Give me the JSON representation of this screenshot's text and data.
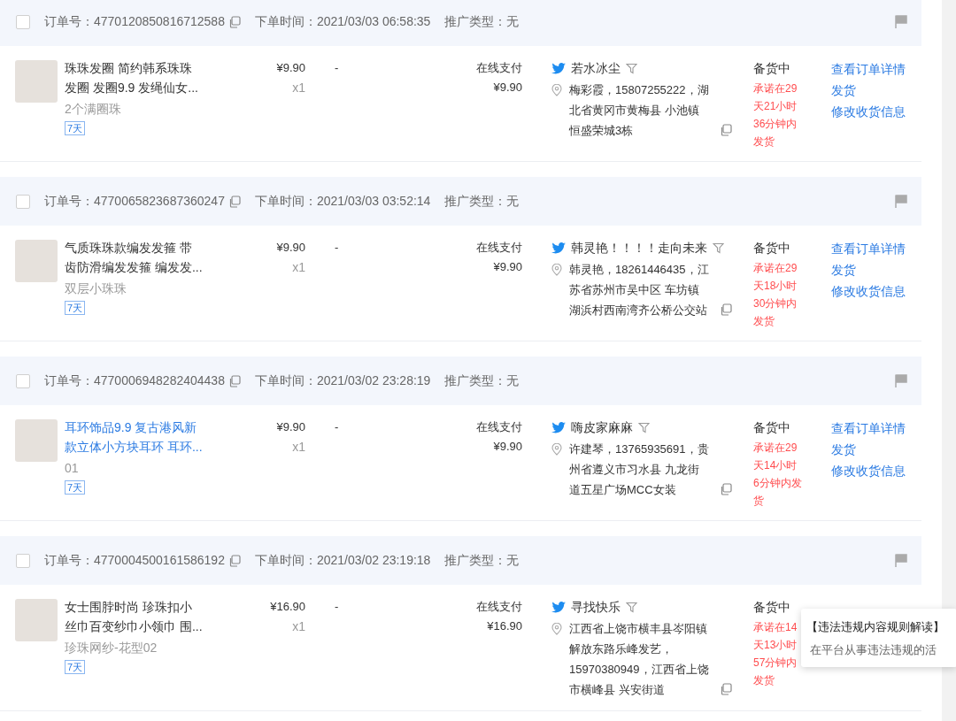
{
  "orders": [
    {
      "selected": false,
      "order_no": "订单号：4770120850816712588",
      "order_time": "下单时间：2021/03/03 06:58:35",
      "promo_type": "推广类型：无",
      "product": {
        "title": "珠珠发圈 简约韩系珠珠发圈 发圈9.9 发绳仙女...",
        "hovered": false,
        "variant": "2个满圈珠",
        "tag": "7天"
      },
      "price": "¥9.90",
      "quantity": "x1",
      "discount": "-",
      "payment_method": "在线支付",
      "paid": "¥9.90",
      "buyer": "若水冰尘",
      "address": "梅彩霞，15807255222，湖北省黄冈市黄梅县 小池镇恒盛荣城3栋",
      "status": "备货中",
      "promise": "承诺在29天21小时36分钟内发货",
      "actions": [
        "查看订单详情",
        "发货",
        "修改收货信息"
      ]
    },
    {
      "selected": false,
      "order_no": "订单号：4770065823687360247",
      "order_time": "下单时间：2021/03/03 03:52:14",
      "promo_type": "推广类型：无",
      "product": {
        "title": "气质珠珠款编发发箍 带齿防滑编发发箍 编发发...",
        "hovered": false,
        "variant": "双层小珠珠",
        "tag": "7天"
      },
      "price": "¥9.90",
      "quantity": "x1",
      "discount": "-",
      "payment_method": "在线支付",
      "paid": "¥9.90",
      "buyer": "韩灵艳！！！！走向未来",
      "address": "韩灵艳，18261446435，江苏省苏州市吴中区 车坊镇湖浜村西南湾齐公桥公交站",
      "status": "备货中",
      "promise": "承诺在29天18小时30分钟内发货",
      "actions": [
        "查看订单详情",
        "发货",
        "修改收货信息"
      ]
    },
    {
      "selected": false,
      "order_no": "订单号：4770006948282404438",
      "order_time": "下单时间：2021/03/02 23:28:19",
      "promo_type": "推广类型：无",
      "product": {
        "title": "耳环饰品9.9 复古港风新款立体小方块耳环 耳环...",
        "hovered": true,
        "variant": "01",
        "tag": "7天"
      },
      "price": "¥9.90",
      "quantity": "x1",
      "discount": "-",
      "payment_method": "在线支付",
      "paid": "¥9.90",
      "buyer": "嗨皮家麻麻",
      "address": "许建琴，13765935691，贵州省遵义市习水县 九龙街道五星广场MCC女装",
      "status": "备货中",
      "promise": "承诺在29天14小时6分钟内发货",
      "actions": [
        "查看订单详情",
        "发货",
        "修改收货信息"
      ]
    },
    {
      "selected": false,
      "order_no": "订单号：4770004500161586192",
      "order_time": "下单时间：2021/03/02 23:19:18",
      "promo_type": "推广类型：无",
      "product": {
        "title": "女士围脖时尚 珍珠扣小丝巾百变纱巾小领巾 围...",
        "hovered": false,
        "variant": "珍珠网纱-花型02",
        "tag": "7天"
      },
      "price": "¥16.90",
      "quantity": "x1",
      "discount": "-",
      "payment_method": "在线支付",
      "paid": "¥16.90",
      "buyer": "寻找快乐",
      "address": "江西省上饶市横丰县岑阳镇解放东路乐峰发艺，15970380949，江西省上饶市横峰县 兴安街道",
      "status": "备货中",
      "promise": "承诺在14天13小时57分钟内发货"
    }
  ],
  "tooltip": {
    "title": "【违法违规内容规则解读】",
    "text": "在平台从事违法违规的活"
  }
}
